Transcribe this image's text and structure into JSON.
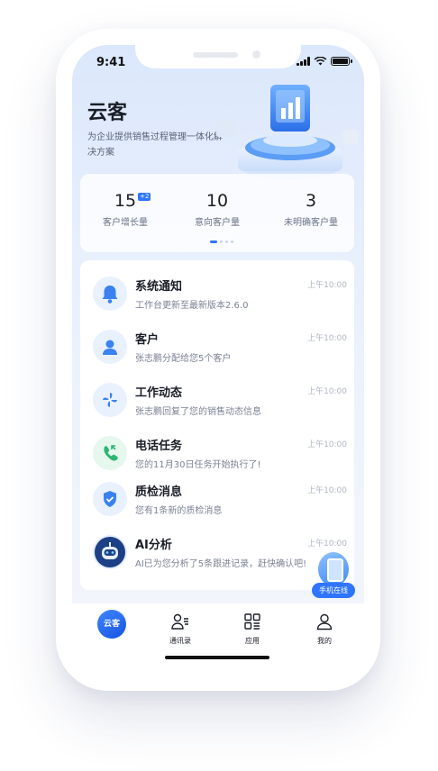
{
  "status_bar": {
    "time": "9:41"
  },
  "header": {
    "title": "云客",
    "subtitle": "为企业提供销售过程管理一体化解决方案"
  },
  "stats": [
    {
      "value": "15",
      "badge": "+2",
      "label": "客户增长量"
    },
    {
      "value": "10",
      "label": "意向客户量"
    },
    {
      "value": "3",
      "label": "未明确客户量"
    }
  ],
  "carousel": {
    "pages": 4,
    "active": 1
  },
  "messages": [
    {
      "icon": "bell-icon",
      "title": "系统通知",
      "desc": "工作台更新至最新版本2.6.0",
      "time": "上午10:00"
    },
    {
      "icon": "person-icon",
      "title": "客户",
      "desc": "张志鹏分配给您5个客户",
      "time": "上午10:00"
    },
    {
      "icon": "pinwheel-icon",
      "title": "工作动态",
      "desc": "张志鹏回复了您的销售动态信息",
      "time": "上午10:00"
    },
    {
      "icon": "phone-call-icon",
      "title": "电话任务",
      "desc": "您的11月30日任务开始执行了!",
      "time": "上午10:00"
    },
    {
      "icon": "shield-check-icon",
      "title": "质检消息",
      "desc": "您有1条新的质检消息",
      "time": "上午10:00"
    },
    {
      "icon": "robot-icon",
      "title": "AI分析",
      "desc": "AI已为您分析了5条跟进记录，赶快确认吧!",
      "time": "上午10:00"
    }
  ],
  "online_badge": {
    "label": "手机在线"
  },
  "tabbar": {
    "tabs": [
      {
        "label": "云客",
        "icon": "yunke-logo-icon",
        "active": true
      },
      {
        "label": "通讯录",
        "icon": "contacts-icon"
      },
      {
        "label": "应用",
        "icon": "apps-grid-icon"
      },
      {
        "label": "我的",
        "icon": "profile-icon"
      }
    ]
  },
  "colors": {
    "accent": "#2f75ff",
    "text": "#1a1e27",
    "muted": "#7a8294",
    "green": "#2bb673"
  }
}
